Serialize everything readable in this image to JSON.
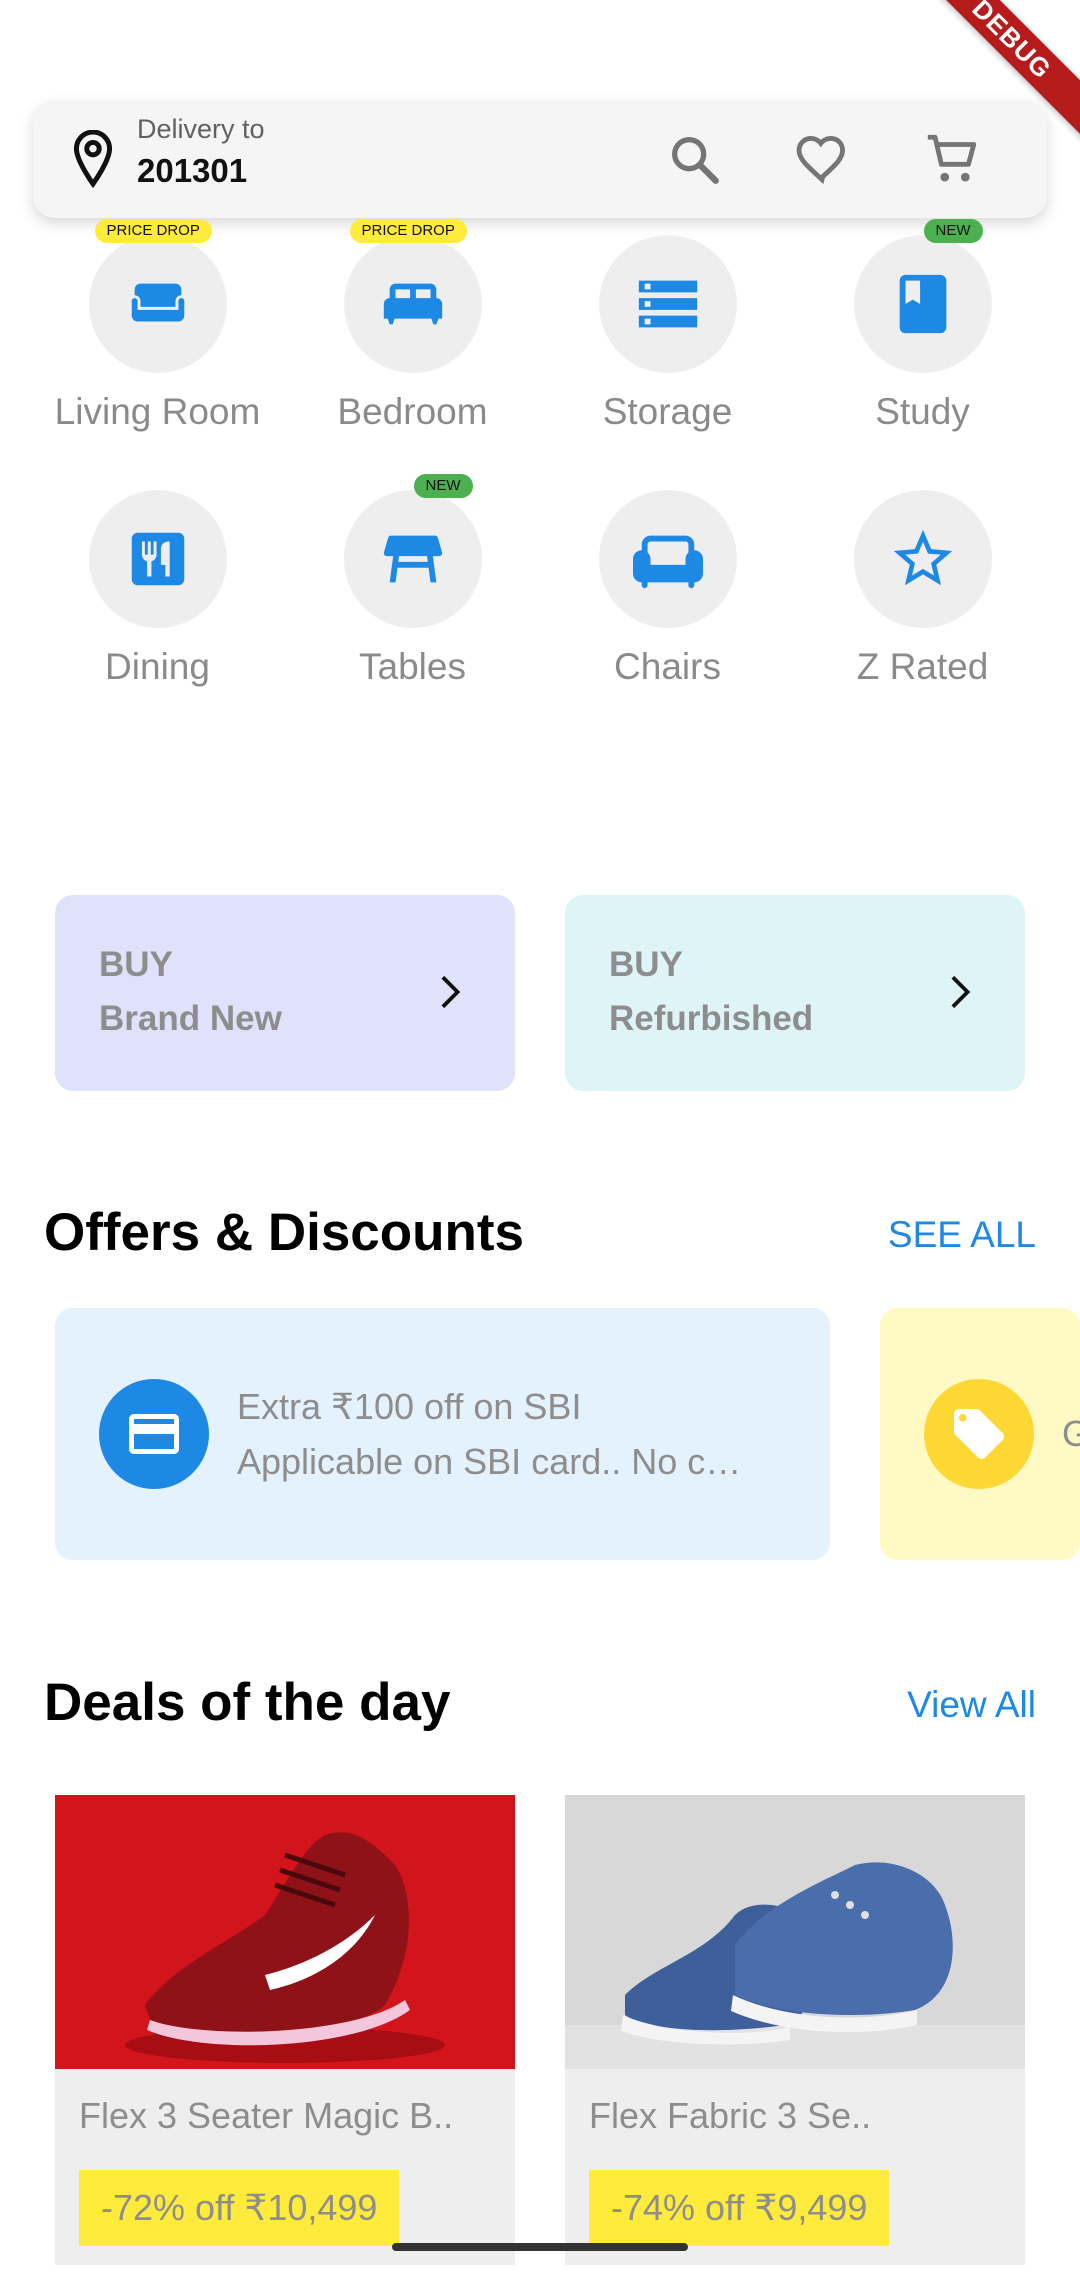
{
  "status_bar": {
    "debug_label": "DEBUG"
  },
  "header": {
    "delivery_label": "Delivery to",
    "pincode": "201301",
    "icons": [
      "location-pin-icon",
      "search-icon",
      "heart-icon",
      "cart-icon"
    ]
  },
  "categories": [
    {
      "label": "Living Room",
      "badge": "PRICE DROP",
      "icon": "sofa-icon"
    },
    {
      "label": "Bedroom",
      "badge": "PRICE DROP",
      "icon": "bed-icon"
    },
    {
      "label": "Storage",
      "badge": "",
      "icon": "storage-icon"
    },
    {
      "label": "Study",
      "badge": "NEW",
      "icon": "book-icon"
    },
    {
      "label": "Dining",
      "badge": "",
      "icon": "dining-icon"
    },
    {
      "label": "Tables",
      "badge": "NEW",
      "icon": "table-icon"
    },
    {
      "label": "Chairs",
      "badge": "",
      "icon": "chair-icon"
    },
    {
      "label": "Z Rated",
      "badge": "",
      "icon": "star-icon"
    }
  ],
  "buy_cards": [
    {
      "line1": "BUY",
      "line2": "Brand New",
      "bg": "#e0e2fb"
    },
    {
      "line1": "BUY",
      "line2": "Refurbished",
      "bg": "#dff4f7"
    }
  ],
  "offers_section": {
    "title": "Offers & Discounts",
    "see_all": "SEE ALL",
    "offers": [
      {
        "title": "Extra ₹100 off on SBI",
        "subtitle": "Applicable on SBI card.. No c…",
        "icon": "credit-card-icon",
        "bg": "#e3f2fd",
        "accent": "#1e88e5"
      },
      {
        "title": "G",
        "subtitle": "",
        "icon": "tag-icon",
        "bg": "#fff9c4",
        "accent": "#fdd835"
      }
    ]
  },
  "deals_section": {
    "title": "Deals of the day",
    "view_all": "View All",
    "deals": [
      {
        "name": "Flex 3 Seater Magic B..",
        "price": "-72% off ₹10,499"
      },
      {
        "name": "Flex Fabric 3 Se..",
        "price": "-74% off ₹9,499"
      }
    ]
  },
  "colors": {
    "accent": "#1e88e5",
    "badge_yellow": "#ffeb3b",
    "badge_green": "#4caf50"
  }
}
